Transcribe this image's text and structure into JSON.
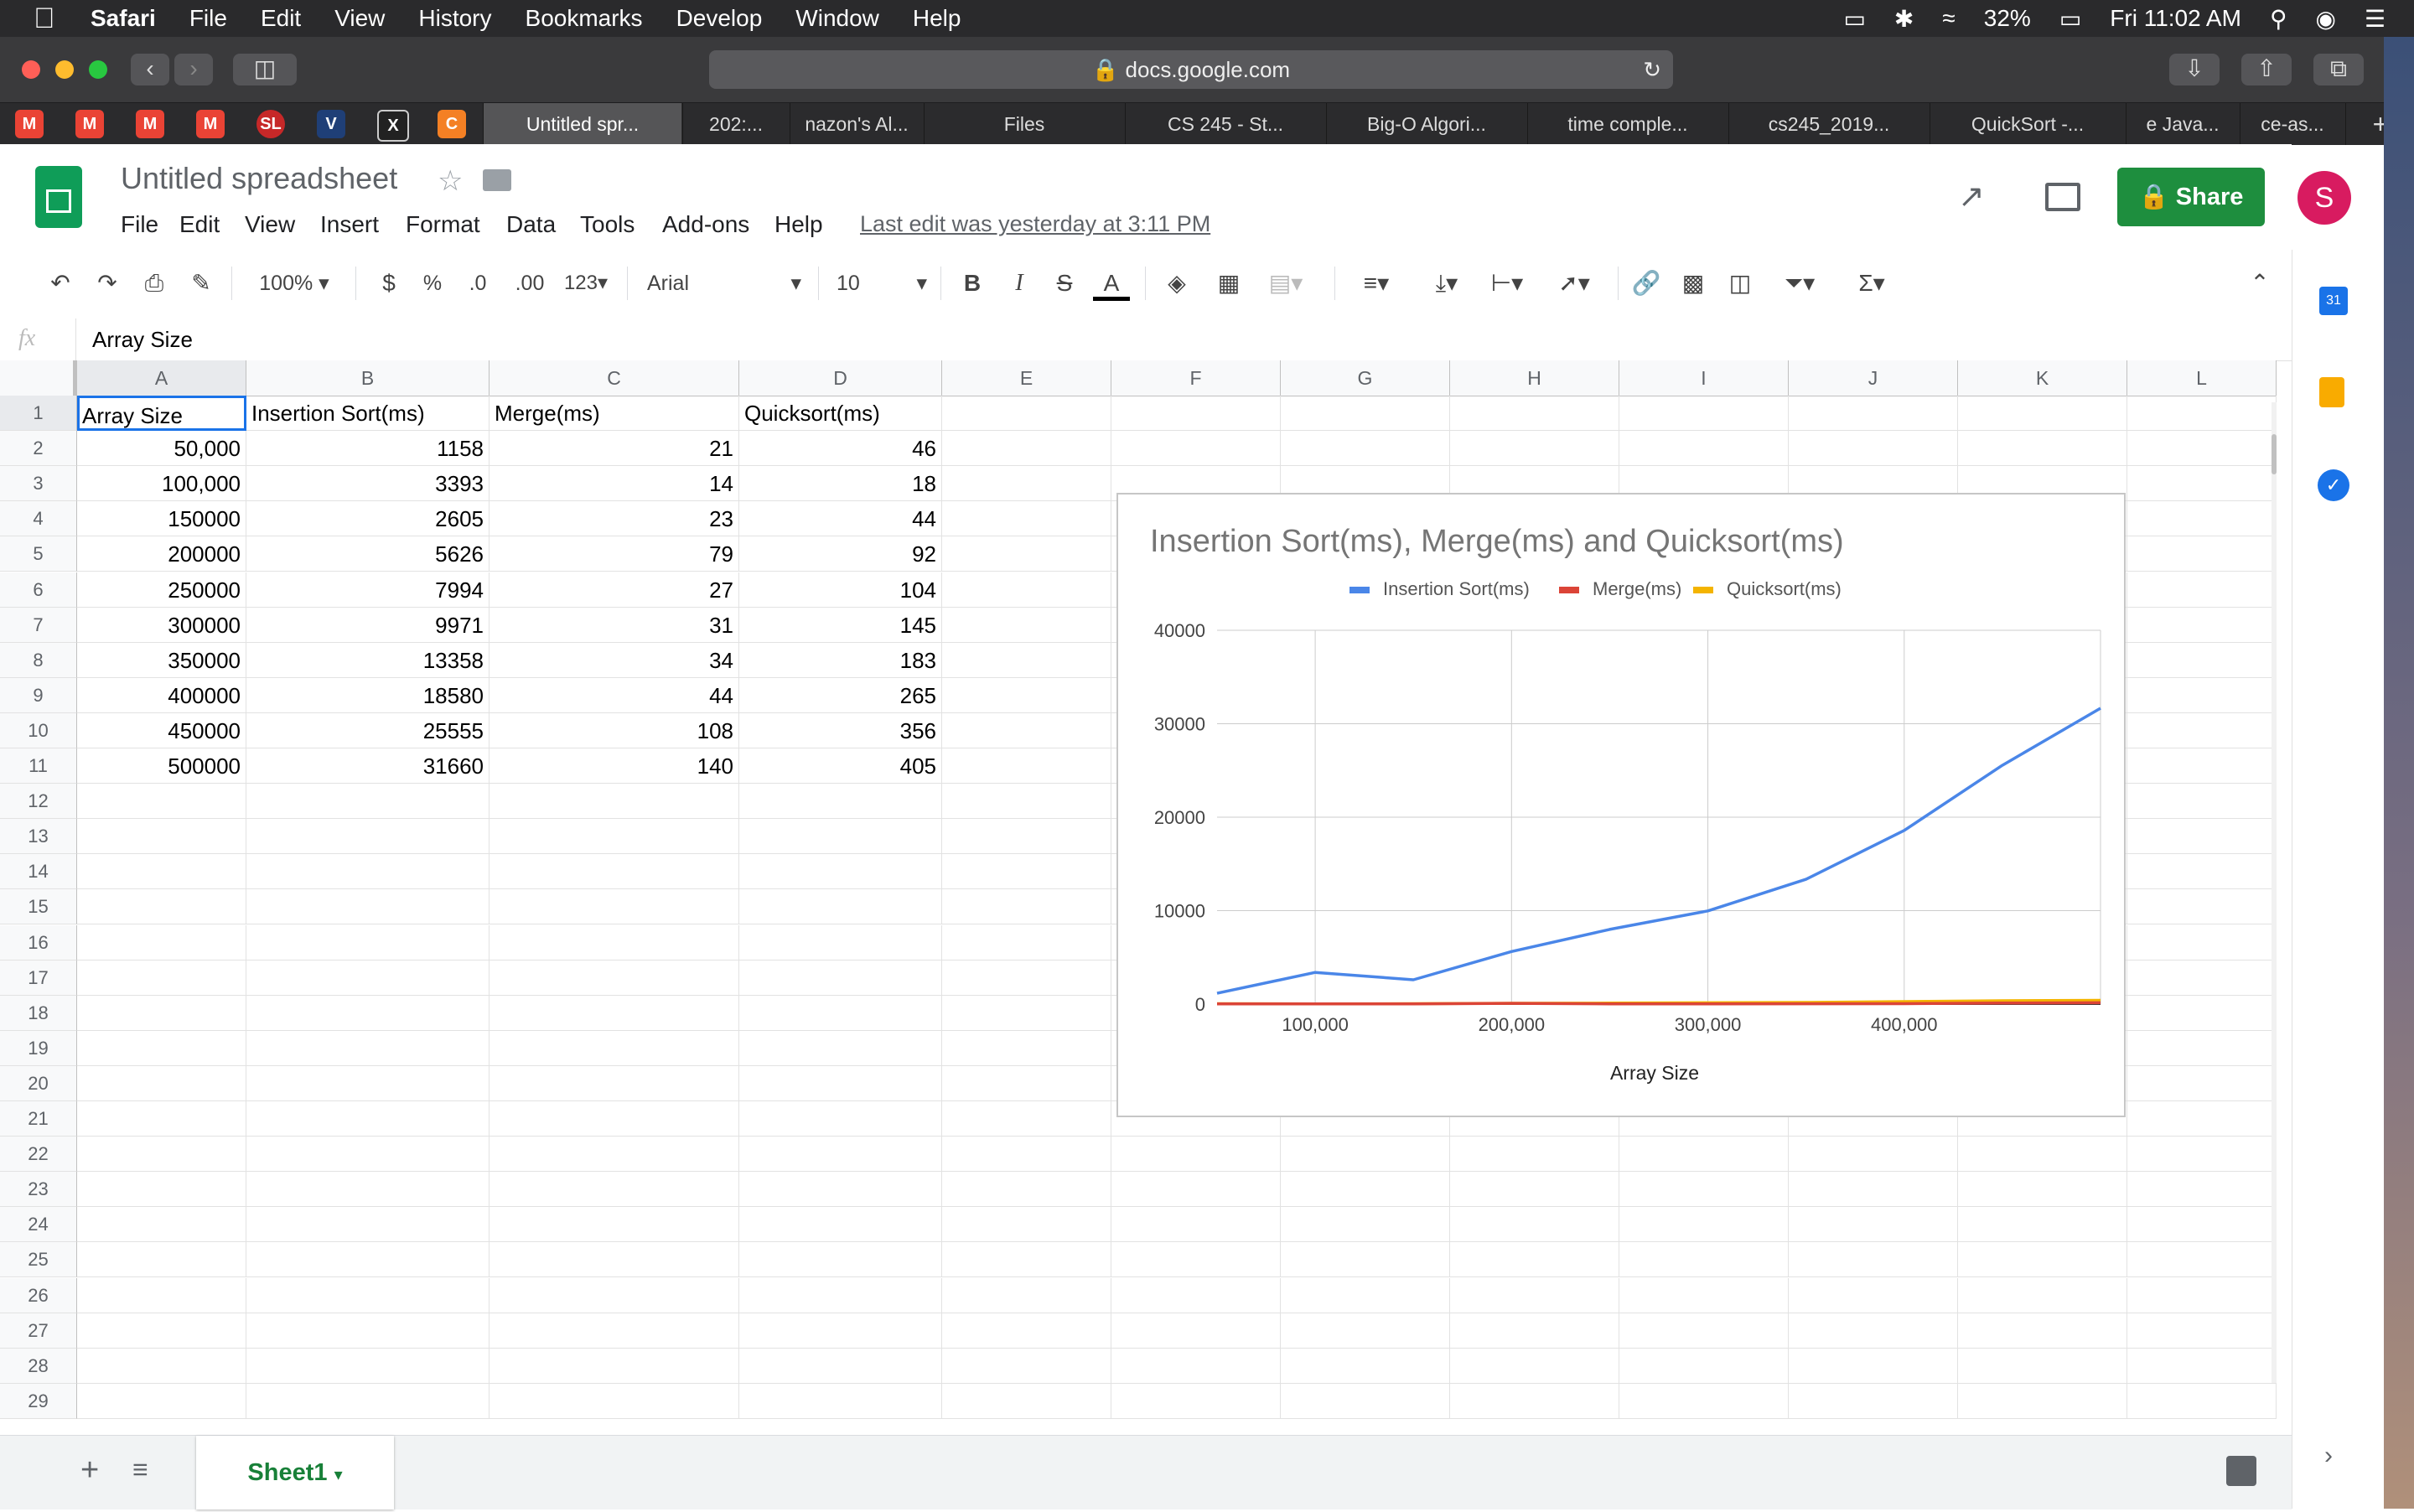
{
  "menubar": {
    "app": "Safari",
    "items": [
      "File",
      "Edit",
      "View",
      "History",
      "Bookmarks",
      "Develop",
      "Window",
      "Help"
    ],
    "battery": "32%",
    "clock": "Fri 11:02 AM"
  },
  "browser": {
    "url": "docs.google.com",
    "tabs": [
      "Untitled spr...",
      "202:...",
      "nazon's Al...",
      "Files",
      "CS 245 - St...",
      "Big-O Algori...",
      "time comple...",
      "cs245_2019...",
      "QuickSort -...",
      "e Java...",
      "ce-as..."
    ],
    "favicon_letters": [
      "M",
      "M",
      "M",
      "M",
      "SL",
      "V",
      "X",
      "C"
    ]
  },
  "sheets": {
    "title": "Untitled spreadsheet",
    "menus": [
      "File",
      "Edit",
      "View",
      "Insert",
      "Format",
      "Data",
      "Tools",
      "Add-ons",
      "Help"
    ],
    "last_edit": "Last edit was yesterday at 3:11 PM",
    "share_label": "Share",
    "avatar_letter": "S",
    "toolbar": {
      "zoom": "100%",
      "currency": "$",
      "percent": "%",
      "dec_decrease": ".0",
      "dec_increase": ".00",
      "number_format": "123",
      "font": "Arial",
      "font_size": "10"
    },
    "formula_fx": "fx",
    "formula_value": "Array Size",
    "sheet_tab": "Sheet1"
  },
  "grid": {
    "columns": [
      "A",
      "B",
      "C",
      "D",
      "E",
      "F",
      "G",
      "H",
      "I",
      "J",
      "K",
      "L"
    ],
    "rows": [
      [
        "Array Size",
        "Insertion Sort(ms)",
        "Merge(ms)",
        "Quicksort(ms)"
      ],
      [
        "50,000",
        "1158",
        "21",
        "46"
      ],
      [
        "100,000",
        "3393",
        "14",
        "18"
      ],
      [
        "150000",
        "2605",
        "23",
        "44"
      ],
      [
        "200000",
        "5626",
        "79",
        "92"
      ],
      [
        "250000",
        "7994",
        "27",
        "104"
      ],
      [
        "300000",
        "9971",
        "31",
        "145"
      ],
      [
        "350000",
        "13358",
        "34",
        "183"
      ],
      [
        "400000",
        "18580",
        "44",
        "265"
      ],
      [
        "450000",
        "25555",
        "108",
        "356"
      ],
      [
        "500000",
        "31660",
        "140",
        "405"
      ]
    ],
    "row_numbers": [
      "1",
      "2",
      "3",
      "4",
      "5",
      "6",
      "7",
      "8",
      "9",
      "10",
      "11",
      "12",
      "13",
      "14",
      "15",
      "16",
      "17",
      "18",
      "19",
      "20",
      "21",
      "22",
      "23",
      "24",
      "25",
      "26",
      "27",
      "28",
      "29"
    ]
  },
  "chart_data": {
    "type": "line",
    "title": "Insertion Sort(ms), Merge(ms) and Quicksort(ms)",
    "xlabel": "Array Size",
    "ylabel": "",
    "x": [
      50000,
      100000,
      150000,
      200000,
      250000,
      300000,
      350000,
      400000,
      450000,
      500000
    ],
    "xticks": [
      "100,000",
      "200,000",
      "300,000",
      "400,000"
    ],
    "xlim": [
      50000,
      500000
    ],
    "ylim": [
      0,
      40000
    ],
    "yticks": [
      "0",
      "10000",
      "20000",
      "30000",
      "40000"
    ],
    "legend_position": "top",
    "grid": true,
    "series": [
      {
        "name": "Insertion Sort(ms)",
        "color": "#4a86e8",
        "values": [
          1158,
          3393,
          2605,
          5626,
          7994,
          9971,
          13358,
          18580,
          25555,
          31660
        ]
      },
      {
        "name": "Merge(ms)",
        "color": "#db4437",
        "values": [
          21,
          14,
          23,
          79,
          27,
          31,
          34,
          44,
          108,
          140
        ]
      },
      {
        "name": "Quicksort(ms)",
        "color": "#f4b400",
        "values": [
          46,
          18,
          44,
          92,
          104,
          145,
          183,
          265,
          356,
          405
        ]
      }
    ]
  }
}
